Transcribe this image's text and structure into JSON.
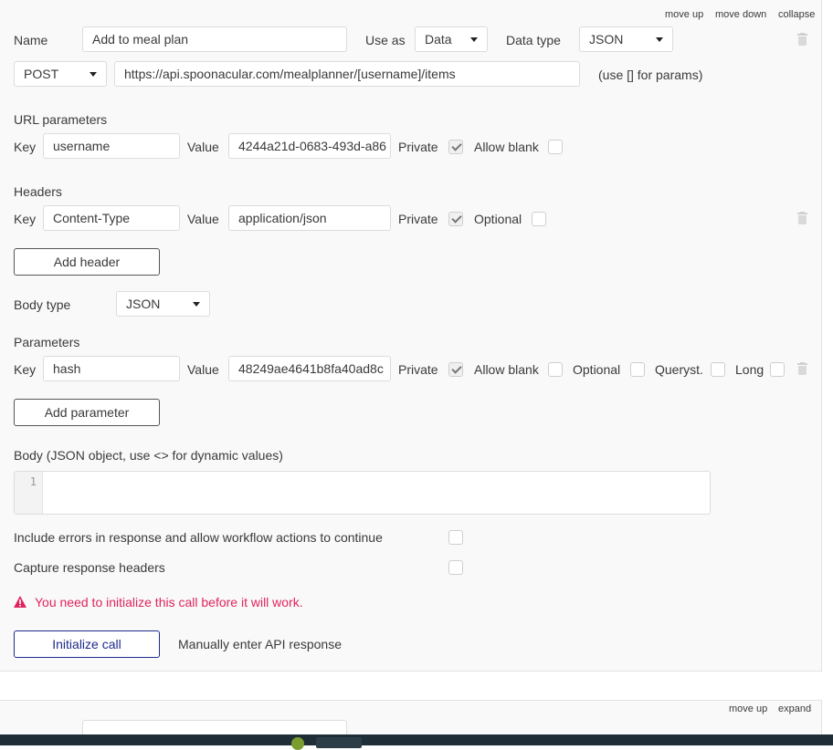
{
  "card": {
    "top_links": {
      "move_up": "move up",
      "move_down": "move down",
      "collapse": "collapse"
    },
    "name_label": "Name",
    "name_value": "Add to meal plan",
    "use_as_label": "Use as",
    "use_as_value": "Data",
    "data_type_label": "Data type",
    "data_type_value": "JSON",
    "method_value": "POST",
    "url_value": "https://api.spoonacular.com/mealplanner/[username]/items",
    "url_hint": "(use [] for params)",
    "url_params": {
      "section_label": "URL parameters",
      "key_label": "Key",
      "key_value": "username",
      "value_label": "Value",
      "value_value": "4244a21d-0683-493d-a86",
      "private_label": "Private",
      "private_checked": true,
      "allow_blank_label": "Allow blank",
      "allow_blank_checked": false
    },
    "headers": {
      "section_label": "Headers",
      "key_label": "Key",
      "key_value": "Content-Type",
      "value_label": "Value",
      "value_value": "application/json",
      "private_label": "Private",
      "private_checked": true,
      "optional_label": "Optional",
      "optional_checked": false,
      "add_button": "Add header"
    },
    "body_type_label": "Body type",
    "body_type_value": "JSON",
    "parameters": {
      "section_label": "Parameters",
      "key_label": "Key",
      "key_value": "hash",
      "value_label": "Value",
      "value_value": "48249ae4641b8fa40ad8c",
      "private_label": "Private",
      "private_checked": true,
      "allow_blank_label": "Allow blank",
      "optional_label": "Optional",
      "queryst_label": "Queryst.",
      "long_label": "Long",
      "add_button": "Add parameter"
    },
    "body_label": "Body (JSON object, use <> for dynamic values)",
    "body_line_number": "1",
    "include_errors_label": "Include errors in response and allow workflow actions to continue",
    "capture_headers_label": "Capture response headers",
    "warning_text": "You need to initialize this call before it will work.",
    "initialize_button": "Initialize call",
    "manual_link": "Manually enter API response"
  },
  "next_card": {
    "top_links": {
      "move_up": "move up",
      "expand": "expand"
    }
  },
  "colors": {
    "warning": "#e0245e",
    "primary_button": "#1d2a8c",
    "taskbar": "#1f2d36"
  }
}
